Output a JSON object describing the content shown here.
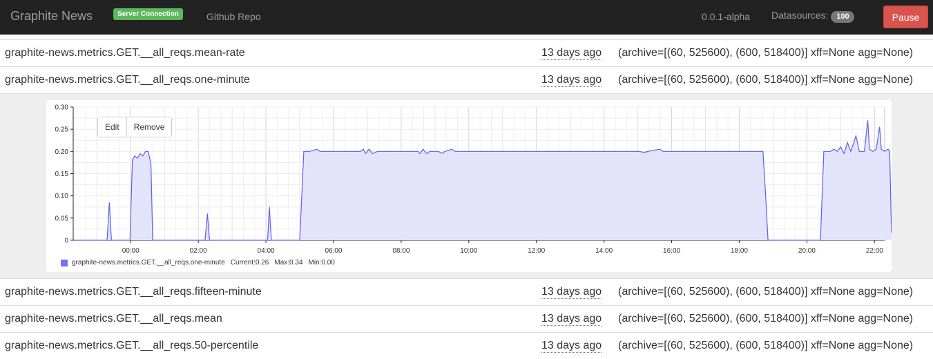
{
  "navbar": {
    "brand": "Graphite News",
    "server_label": "Server Connection",
    "github_link": "Github Repo",
    "version": "0.0.1-alpha",
    "datasources_label": "Datasources:",
    "datasources_count": "100",
    "pause_label": "Pause"
  },
  "rows": [
    {
      "name": "graphite-news.metrics.GET.__all_reqs.mean-rate",
      "when": "13 days ago",
      "info": "(archive=[(60, 525600), (600, 518400)] xff=None agg=None)"
    },
    {
      "name": "graphite-news.metrics.GET.__all_reqs.one-minute",
      "when": "13 days ago",
      "info": "(archive=[(60, 525600), (600, 518400)] xff=None agg=None)"
    },
    {
      "name": "graphite-news.metrics.GET.__all_reqs.fifteen-minute",
      "when": "13 days ago",
      "info": "(archive=[(60, 525600), (600, 518400)] xff=None agg=None)"
    },
    {
      "name": "graphite-news.metrics.GET.__all_reqs.mean",
      "when": "13 days ago",
      "info": "(archive=[(60, 525600), (600, 518400)] xff=None agg=None)"
    },
    {
      "name": "graphite-news.metrics.GET.__all_reqs.50-percentile",
      "when": "13 days ago",
      "info": "(archive=[(60, 525600), (600, 518400)] xff=None agg=None)"
    }
  ],
  "chart_controls": {
    "edit_label": "Edit",
    "remove_label": "Remove"
  },
  "legend": {
    "series": "graphite-news.metrics.GET.__all_reqs.one-minute",
    "current": "Current:0.26",
    "max": "Max:0.34",
    "min": "Min:0.00"
  },
  "colors": {
    "navbar": "#222222",
    "success": "#5cb85c",
    "danger": "#d9534f",
    "series_line": "#5b5ff0",
    "series_fill": "#e3e4fb"
  },
  "chart_data": {
    "type": "area",
    "xticks": [
      "00:00",
      "02:00",
      "04:00",
      "06:00",
      "08:00",
      "10:00",
      "12:00",
      "14:00",
      "16:00",
      "18:00",
      "20:00",
      "22:00"
    ],
    "yticks": [
      "0",
      "0.05",
      "0.10",
      "0.15",
      "0.20",
      "0.25",
      "0.30"
    ],
    "ylim": [
      0,
      0.3
    ],
    "xlim_hours": [
      -1.7,
      22.3
    ],
    "series": [
      {
        "name": "graphite-news.metrics.GET.__all_reqs.one-minute",
        "points": [
          [
            -1.7,
            0
          ],
          [
            -0.7,
            0
          ],
          [
            -0.63,
            0.085
          ],
          [
            -0.57,
            0
          ],
          [
            -0.02,
            0
          ],
          [
            0.05,
            0.18
          ],
          [
            0.12,
            0.19
          ],
          [
            0.2,
            0.185
          ],
          [
            0.28,
            0.195
          ],
          [
            0.36,
            0.19
          ],
          [
            0.44,
            0.2
          ],
          [
            0.52,
            0.2
          ],
          [
            0.6,
            0.17
          ],
          [
            0.65,
            0
          ],
          [
            2.2,
            0
          ],
          [
            2.27,
            0.06
          ],
          [
            2.33,
            0
          ],
          [
            4.05,
            0
          ],
          [
            4.1,
            0.075
          ],
          [
            4.16,
            0
          ],
          [
            5.0,
            0
          ],
          [
            5.12,
            0.2
          ],
          [
            5.3,
            0.2
          ],
          [
            5.5,
            0.205
          ],
          [
            5.6,
            0.2
          ],
          [
            6.0,
            0.2
          ],
          [
            6.8,
            0.2
          ],
          [
            6.88,
            0.205
          ],
          [
            6.95,
            0.195
          ],
          [
            7.05,
            0.205
          ],
          [
            7.15,
            0.195
          ],
          [
            7.3,
            0.2
          ],
          [
            8.5,
            0.2
          ],
          [
            8.55,
            0.195
          ],
          [
            8.65,
            0.205
          ],
          [
            8.75,
            0.195
          ],
          [
            8.85,
            0.2
          ],
          [
            9.1,
            0.2
          ],
          [
            9.2,
            0.196
          ],
          [
            9.3,
            0.2
          ],
          [
            9.5,
            0.205
          ],
          [
            9.6,
            0.2
          ],
          [
            15.0,
            0.2
          ],
          [
            15.2,
            0.198
          ],
          [
            15.3,
            0.2
          ],
          [
            15.65,
            0.205
          ],
          [
            15.75,
            0.2
          ],
          [
            18.7,
            0.2
          ],
          [
            18.78,
            0.1
          ],
          [
            18.85,
            0
          ],
          [
            20.4,
            0
          ],
          [
            20.5,
            0.2
          ],
          [
            20.7,
            0.2
          ],
          [
            20.8,
            0.205
          ],
          [
            20.9,
            0.2
          ],
          [
            21.0,
            0.21
          ],
          [
            21.1,
            0.195
          ],
          [
            21.2,
            0.22
          ],
          [
            21.3,
            0.2
          ],
          [
            21.45,
            0.235
          ],
          [
            21.55,
            0.2
          ],
          [
            21.7,
            0.2
          ],
          [
            21.8,
            0.27
          ],
          [
            21.85,
            0.205
          ],
          [
            21.95,
            0.2
          ],
          [
            22.05,
            0.205
          ],
          [
            22.15,
            0.255
          ],
          [
            22.2,
            0.205
          ],
          [
            22.3,
            0.2
          ],
          [
            22.4,
            0.205
          ],
          [
            22.45,
            0.2
          ],
          [
            22.5,
            0.02
          ],
          [
            22.55,
            0
          ],
          [
            22.6,
            0.13
          ]
        ]
      }
    ]
  }
}
